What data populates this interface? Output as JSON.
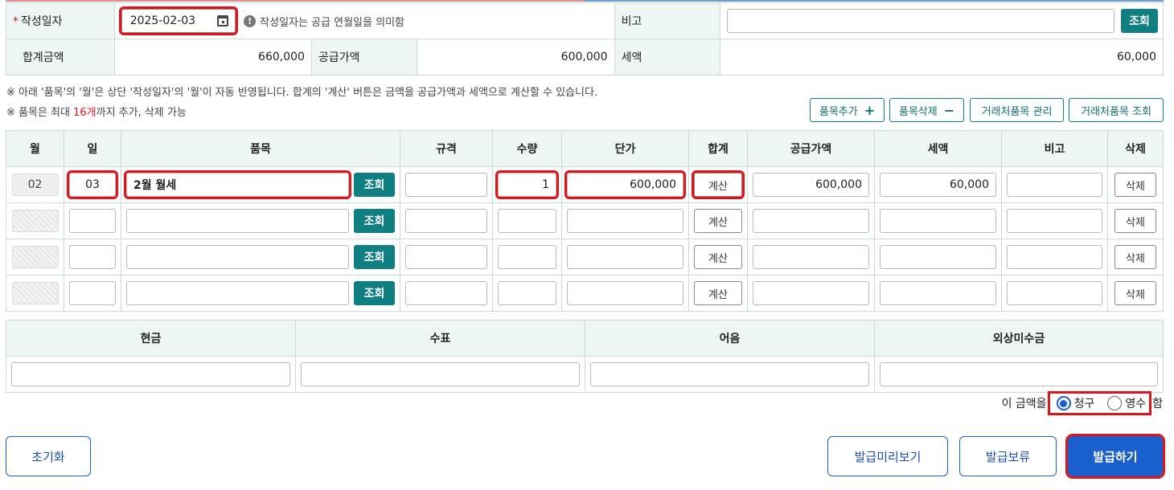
{
  "colors": {
    "accent_teal": "#0f7f82",
    "primary_blue": "#1a5fd0",
    "highlight_red": "#e0141b"
  },
  "header": {
    "date_label": "작성일자",
    "date_value": "2025-02-03",
    "date_notice": "작성일자는 공급 연월일을 의미함",
    "remark_label": "비고",
    "remark_value": "",
    "lookup_label": "조회",
    "total_label": "합계금액",
    "total_value": "660,000",
    "supply_label": "공급가액",
    "supply_value": "600,000",
    "tax_label": "세액",
    "tax_value": "60,000"
  },
  "notes": {
    "line1": "※ 아래 '품목'의 '월'은 상단 '작성일자'의 '월'이 자동 반영됩니다. 합계의 '계산' 버튼은 금액을 공급가액과 세액으로 계산할 수 있습니다.",
    "line2_pre": "※ 품목은 최대 ",
    "line2_red": "16개",
    "line2_post": "까지 추가, 삭제 가능"
  },
  "toolbar": {
    "add_item": "품목추가",
    "add_symbol": "+",
    "delete_item": "품목삭제",
    "delete_symbol": "−",
    "manage_partner_items": "거래처품목 관리",
    "lookup_partner_items": "거래처품목 조회"
  },
  "grid": {
    "columns": [
      "월",
      "일",
      "품목",
      "규격",
      "수량",
      "단가",
      "합계",
      "공급가액",
      "세액",
      "비고",
      "삭제"
    ],
    "lookup_label": "조회",
    "calc_label": "계산",
    "delete_label": "삭제",
    "rows": [
      {
        "month": "02",
        "day": "03",
        "item": "2월 월세",
        "spec": "",
        "qty": "1",
        "unit_price": "600,000",
        "supply": "600,000",
        "tax": "60,000",
        "remark": ""
      },
      {
        "month": "",
        "day": "",
        "item": "",
        "spec": "",
        "qty": "",
        "unit_price": "",
        "supply": "",
        "tax": "",
        "remark": ""
      },
      {
        "month": "",
        "day": "",
        "item": "",
        "spec": "",
        "qty": "",
        "unit_price": "",
        "supply": "",
        "tax": "",
        "remark": ""
      },
      {
        "month": "",
        "day": "",
        "item": "",
        "spec": "",
        "qty": "",
        "unit_price": "",
        "supply": "",
        "tax": "",
        "remark": ""
      }
    ]
  },
  "payment": {
    "columns": [
      "현금",
      "수표",
      "어음",
      "외상미수금"
    ]
  },
  "amount_type": {
    "prefix": "이 금액을",
    "option_claim": "청구",
    "option_receipt": "영수",
    "suffix": "함",
    "selected": "청구"
  },
  "footer": {
    "reset": "초기화",
    "preview": "발급미리보기",
    "hold": "발급보류",
    "issue": "발급하기"
  }
}
